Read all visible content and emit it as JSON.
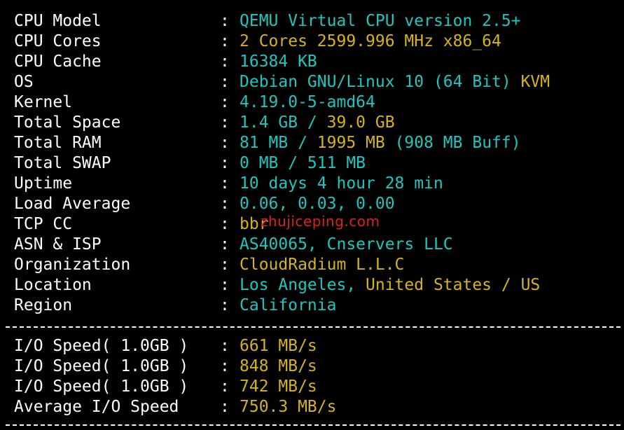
{
  "colors": {
    "background": "#000000",
    "label": "#ffffff",
    "cyan": "#1cc7c0",
    "yellow": "#d6b21e",
    "watermark": "#e0201a"
  },
  "separator": ":",
  "rows": [
    {
      "label": "CPU Model",
      "parts": [
        {
          "text": "QEMU Virtual CPU version 2.5+",
          "color": "cyan"
        }
      ]
    },
    {
      "label": "CPU Cores",
      "parts": [
        {
          "text": "2 Cores 2599.996 MHz x86_64",
          "color": "yellow"
        }
      ]
    },
    {
      "label": "CPU Cache",
      "parts": [
        {
          "text": "16384 KB",
          "color": "cyan"
        }
      ]
    },
    {
      "label": "OS",
      "parts": [
        {
          "text": "Debian GNU/Linux 10 (64 Bit) ",
          "color": "cyan"
        },
        {
          "text": "KVM",
          "color": "yellow"
        }
      ]
    },
    {
      "label": "Kernel",
      "parts": [
        {
          "text": "4.19.0-5-amd64",
          "color": "cyan"
        }
      ]
    },
    {
      "label": "Total Space",
      "parts": [
        {
          "text": "1.4 GB / ",
          "color": "cyan"
        },
        {
          "text": "39.0 GB",
          "color": "yellow"
        }
      ]
    },
    {
      "label": "Total RAM",
      "parts": [
        {
          "text": "81 MB / ",
          "color": "cyan"
        },
        {
          "text": "1995 MB",
          "color": "yellow"
        },
        {
          "text": " (908 MB Buff)",
          "color": "cyan"
        }
      ]
    },
    {
      "label": "Total SWAP",
      "parts": [
        {
          "text": "0 MB / 511 MB",
          "color": "cyan"
        }
      ]
    },
    {
      "label": "Uptime",
      "parts": [
        {
          "text": "10 days 4 hour 28 min",
          "color": "cyan"
        }
      ]
    },
    {
      "label": "Load Average",
      "parts": [
        {
          "text": "0.06, 0.03, 0.00",
          "color": "cyan"
        }
      ]
    },
    {
      "label": "TCP CC",
      "parts": [
        {
          "text": "bbr",
          "color": "yellow"
        }
      ]
    },
    {
      "label": "ASN & ISP",
      "parts": [
        {
          "text": "AS40065, Cnservers LLC",
          "color": "cyan"
        }
      ]
    },
    {
      "label": "Organization",
      "parts": [
        {
          "text": "CloudRadium L.L.C",
          "color": "yellow"
        }
      ]
    },
    {
      "label": "Location",
      "parts": [
        {
          "text": "Los Angeles, ",
          "color": "cyan"
        },
        {
          "text": "United States / US",
          "color": "yellow"
        }
      ]
    },
    {
      "label": "Region",
      "parts": [
        {
          "text": "California",
          "color": "cyan"
        }
      ]
    }
  ],
  "io_rows": [
    {
      "label": "I/O Speed( 1.0GB )",
      "parts": [
        {
          "text": "661 MB/s",
          "color": "yellow"
        }
      ]
    },
    {
      "label": "I/O Speed( 1.0GB )",
      "parts": [
        {
          "text": "848 MB/s",
          "color": "yellow"
        }
      ]
    },
    {
      "label": "I/O Speed( 1.0GB )",
      "parts": [
        {
          "text": "742 MB/s",
          "color": "yellow"
        }
      ]
    },
    {
      "label": "Average I/O Speed",
      "parts": [
        {
          "text": "750.3 MB/s",
          "color": "yellow"
        }
      ]
    }
  ],
  "watermark": "zhujiceping.com"
}
